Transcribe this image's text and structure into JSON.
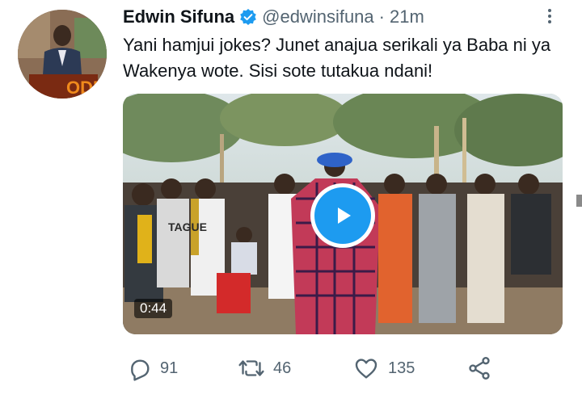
{
  "tweet": {
    "author_name": "Edwin Sifuna",
    "handle": "@edwinsifuna",
    "separator": "·",
    "time": "21m",
    "text": "Yani hamjui jokes? Junet anajua serikali ya Baba ni ya Wakenya wote. Sisi sote tutakua ndani!",
    "avatar_sign_text": "ODM"
  },
  "media": {
    "type": "video",
    "duration": "0:44",
    "shirt_text": "TAGUE"
  },
  "actions": {
    "reply_count": "91",
    "retweet_count": "46",
    "like_count": "135"
  },
  "icons": {
    "verified": "verified-badge-icon",
    "more": "more-options-icon",
    "reply": "reply-icon",
    "retweet": "retweet-icon",
    "like": "heart-icon",
    "share": "share-icon",
    "play": "play-icon"
  },
  "colors": {
    "accent": "#1d9bf0",
    "text_primary": "#0f1419",
    "text_secondary": "#536471"
  }
}
